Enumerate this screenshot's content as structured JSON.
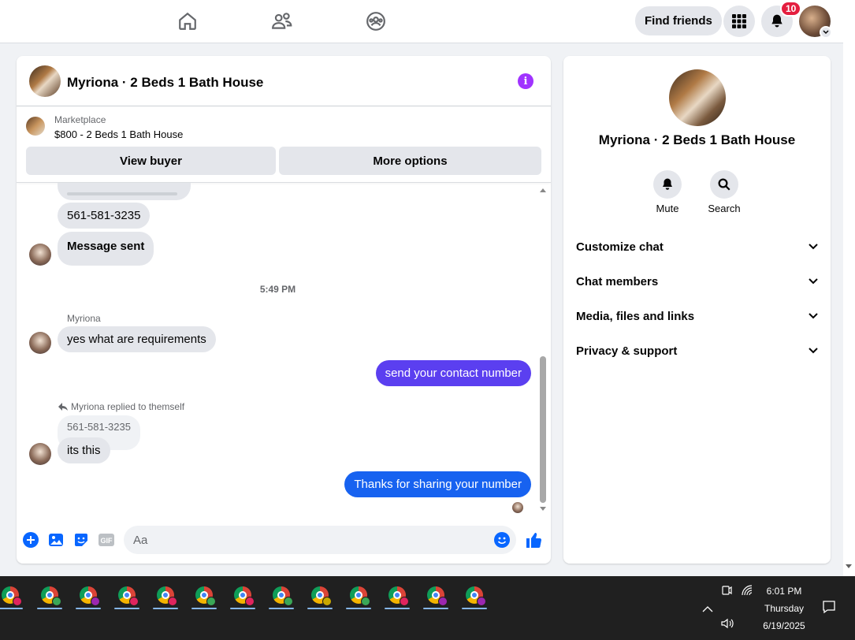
{
  "topbar": {
    "nav": [
      "home-icon",
      "friends-icon",
      "groups-icon"
    ],
    "find_friends_label": "Find friends",
    "notification_count": "10"
  },
  "chat": {
    "title": "Myriona · 2 Beds 1 Bath House",
    "marketplace_label": "Marketplace",
    "listing": "$800 - 2 Beds 1 Bath House",
    "view_buyer_label": "View buyer",
    "more_options_label": "More options",
    "messages": {
      "phone_1": "561-581-3235",
      "message_sent": "Message sent",
      "timestamp": "5:49 PM",
      "sender_name": "Myriona",
      "incoming_1": "yes what are requirements",
      "outgoing_1": "send your contact number",
      "reply_note": "Myriona replied to themself",
      "reply_quote": "561-581-3235",
      "incoming_2": "its this",
      "outgoing_2": "Thanks for sharing your number"
    },
    "composer": {
      "placeholder": "Aa"
    },
    "colors": {
      "outgoing_1": "#5b3ff0",
      "outgoing_2": "#1762f0"
    }
  },
  "details": {
    "title": "Myriona · 2 Beds 1 Bath House",
    "mute_label": "Mute",
    "search_label": "Search",
    "sections": [
      "Customize chat",
      "Chat members",
      "Media, files and links",
      "Privacy & support"
    ]
  },
  "taskbar": {
    "time": "6:01 PM",
    "day": "Thursday",
    "date": "6/19/2025",
    "profile_colors": [
      "#e0245e",
      "#3aa757",
      "#9c27b0",
      "#e0245e",
      "#e0245e",
      "#3aa757",
      "#e0245e",
      "#3aa757",
      "#c8a800",
      "#3aa757",
      "#e0245e",
      "#9c27b0",
      "#9c27b0"
    ]
  }
}
